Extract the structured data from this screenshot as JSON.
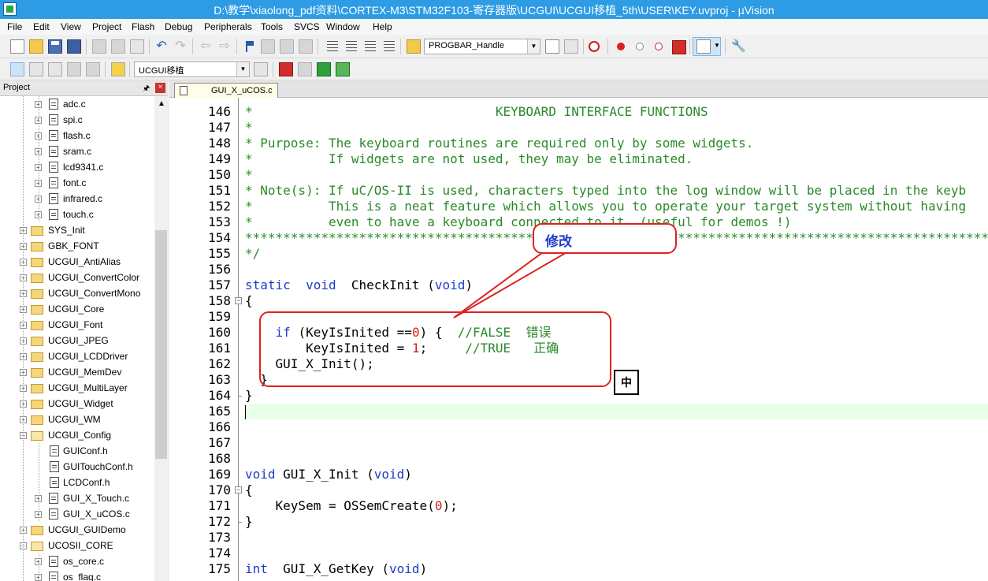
{
  "window": {
    "title": "D:\\教学\\xiaolong_pdf资料\\CORTEX-M3\\STM32F103-寄存器版\\UCGUI\\UCGUI移植_5th\\USER\\KEY.uvproj - µVision"
  },
  "menu": [
    "File",
    "Edit",
    "View",
    "Project",
    "Flash",
    "Debug",
    "Peripherals",
    "Tools",
    "SVCS",
    "Window",
    "Help"
  ],
  "toolbar1": {
    "function_combo": "PROGBAR_Handle"
  },
  "toolbar2": {
    "target_combo": "UCGUI移植"
  },
  "project_panel": {
    "title": "Project",
    "tree": [
      {
        "label": "adc.c",
        "kind": "file"
      },
      {
        "label": "spi.c",
        "kind": "file"
      },
      {
        "label": "flash.c",
        "kind": "file"
      },
      {
        "label": "sram.c",
        "kind": "file"
      },
      {
        "label": "lcd9341.c",
        "kind": "file"
      },
      {
        "label": "font.c",
        "kind": "file"
      },
      {
        "label": "infrared.c",
        "kind": "file"
      },
      {
        "label": "touch.c",
        "kind": "file"
      },
      {
        "label": "SYS_Init",
        "kind": "group"
      },
      {
        "label": "GBK_FONT",
        "kind": "group"
      },
      {
        "label": "UCGUI_AntiAlias",
        "kind": "group"
      },
      {
        "label": "UCGUI_ConvertColor",
        "kind": "group"
      },
      {
        "label": "UCGUI_ConvertMono",
        "kind": "group"
      },
      {
        "label": "UCGUI_Core",
        "kind": "group"
      },
      {
        "label": "UCGUI_Font",
        "kind": "group"
      },
      {
        "label": "UCGUI_JPEG",
        "kind": "group"
      },
      {
        "label": "UCGUI_LCDDriver",
        "kind": "group"
      },
      {
        "label": "UCGUI_MemDev",
        "kind": "group"
      },
      {
        "label": "UCGUI_MultiLayer",
        "kind": "group"
      },
      {
        "label": "UCGUI_Widget",
        "kind": "group"
      },
      {
        "label": "UCGUI_WM",
        "kind": "group"
      },
      {
        "label": "UCGUI_Config",
        "kind": "group-open"
      },
      {
        "label": "GUIConf.h",
        "kind": "leaf"
      },
      {
        "label": "GUITouchConf.h",
        "kind": "leaf"
      },
      {
        "label": "LCDConf.h",
        "kind": "leaf"
      },
      {
        "label": "GUI_X_Touch.c",
        "kind": "file"
      },
      {
        "label": "GUI_X_uCOS.c",
        "kind": "file"
      },
      {
        "label": "UCGUI_GUIDemo",
        "kind": "group"
      },
      {
        "label": "UCOSII_CORE",
        "kind": "group-open"
      },
      {
        "label": "os_core.c",
        "kind": "file"
      },
      {
        "label": "os_flag.c",
        "kind": "file"
      }
    ]
  },
  "editor": {
    "tab": "GUI_X_uCOS.c",
    "lines": [
      {
        "n": "146",
        "t": "*                                KEYBOARD INTERFACE FUNCTIONS",
        "c": "cm"
      },
      {
        "n": "147",
        "t": "*",
        "c": "cm"
      },
      {
        "n": "148",
        "t": "* Purpose: The keyboard routines are required only by some widgets.",
        "c": "cm"
      },
      {
        "n": "149",
        "t": "*          If widgets are not used, they may be eliminated.",
        "c": "cm"
      },
      {
        "n": "150",
        "t": "*",
        "c": "cm"
      },
      {
        "n": "151",
        "t": "* Note(s): If uC/OS-II is used, characters typed into the log window will be placed in the keyb",
        "c": "cm"
      },
      {
        "n": "152",
        "t": "*          This is a neat feature which allows you to operate your target system without having",
        "c": "cm"
      },
      {
        "n": "153",
        "t": "*          even to have a keyboard connected to it. (useful for demos !)",
        "c": "cm"
      },
      {
        "n": "154",
        "t": "***********************************************************************************************************",
        "c": "cm"
      },
      {
        "n": "155",
        "t": "*/",
        "c": "cm"
      },
      {
        "n": "156",
        "t": "",
        "c": ""
      },
      {
        "n": "157",
        "t": "",
        "c": "mixed157"
      },
      {
        "n": "158",
        "t": "{",
        "c": ""
      },
      {
        "n": "159",
        "t": "",
        "c": ""
      },
      {
        "n": "160",
        "t": "",
        "c": "mixed160"
      },
      {
        "n": "161",
        "t": "",
        "c": "mixed161"
      },
      {
        "n": "162",
        "t": "    GUI_X_Init();",
        "c": ""
      },
      {
        "n": "163",
        "t": "  }",
        "c": ""
      },
      {
        "n": "164",
        "t": "}",
        "c": ""
      },
      {
        "n": "165",
        "t": "",
        "c": "hl"
      },
      {
        "n": "166",
        "t": "",
        "c": ""
      },
      {
        "n": "167",
        "t": "",
        "c": ""
      },
      {
        "n": "168",
        "t": "",
        "c": ""
      },
      {
        "n": "169",
        "t": "",
        "c": "mixed169"
      },
      {
        "n": "170",
        "t": "{",
        "c": ""
      },
      {
        "n": "171",
        "t": "",
        "c": "mixed171"
      },
      {
        "n": "172",
        "t": "}",
        "c": ""
      },
      {
        "n": "173",
        "t": "",
        "c": ""
      },
      {
        "n": "174",
        "t": "",
        "c": ""
      },
      {
        "n": "175",
        "t": "",
        "c": "mixed175"
      }
    ],
    "tokens": {
      "l157": {
        "kw1": "static",
        "kw2": "void",
        "fn": "CheckInit",
        "kw3": "void"
      },
      "l160": {
        "kw": "if",
        "pre": "(KeyIsInited ==",
        "num": "0",
        "post": ") {",
        "comment": "//FALSE  错误"
      },
      "l161": {
        "pre": "KeyIsInited = ",
        "num": "1",
        "post": ";",
        "comment": "//TRUE   正确"
      },
      "l169": {
        "kw1": "void",
        "fn": "GUI_X_Init",
        "kw2": "void"
      },
      "l171": {
        "pre": "KeySem = OSSemCreate(",
        "num": "0",
        "post": ");"
      },
      "l175": {
        "kw1": "int",
        "fn": "GUI_X_GetKey",
        "kw2": "void"
      }
    }
  },
  "annotations": {
    "callout": "修改",
    "ime": "中"
  },
  "colors": {
    "titlebar": "#2d9ce5",
    "annotation_red": "#e02020",
    "comment_green": "#2a8a2a",
    "keyword_blue": "#1e3cc8",
    "number_red": "#d12020"
  }
}
